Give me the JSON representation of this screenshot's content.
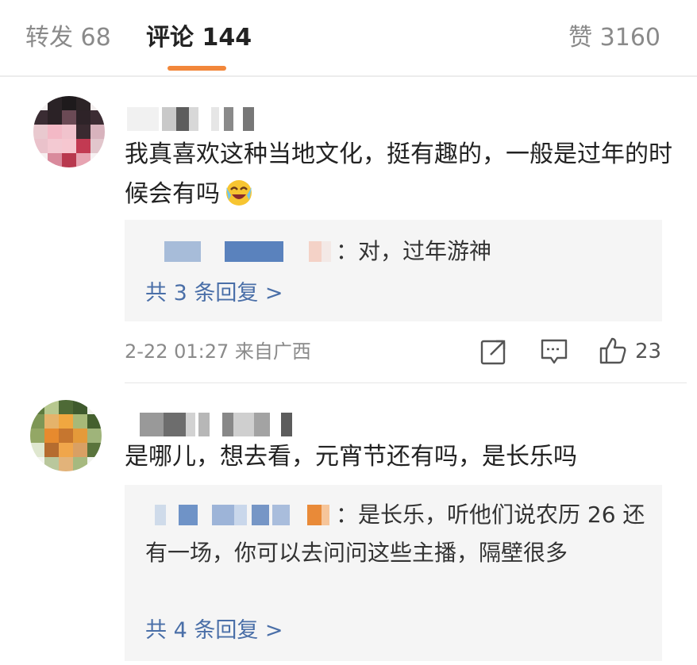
{
  "tabs": {
    "repost": {
      "label": "转发",
      "count": "68"
    },
    "comment": {
      "label": "评论",
      "count": "144"
    },
    "like": {
      "label": "赞",
      "count": "3160"
    }
  },
  "comments": [
    {
      "text": "我真喜欢这种当地文化，挺有趣的，一般是过年的时候会有吗",
      "emoji": "laughing-tears-emoji",
      "reply_preview": "：对，过年游神",
      "more_replies": "共 3 条回复 >",
      "time_location": "2-22 01:27 来自广西",
      "like_count": "23"
    },
    {
      "text": "是哪儿，想去看，元宵节还有吗，是长乐吗",
      "reply_preview": "：是长乐，听他们说农历 26 还有一场，你可以去问问这些主播，隔壁很多",
      "more_replies": "共 4 条回复 >"
    }
  ],
  "icons": [
    "repost-icon",
    "comment-icon",
    "like-icon"
  ],
  "colors": {
    "accent": "#f2873a",
    "link": "#4a6fa8",
    "reply_bg": "#f5f5f5"
  }
}
